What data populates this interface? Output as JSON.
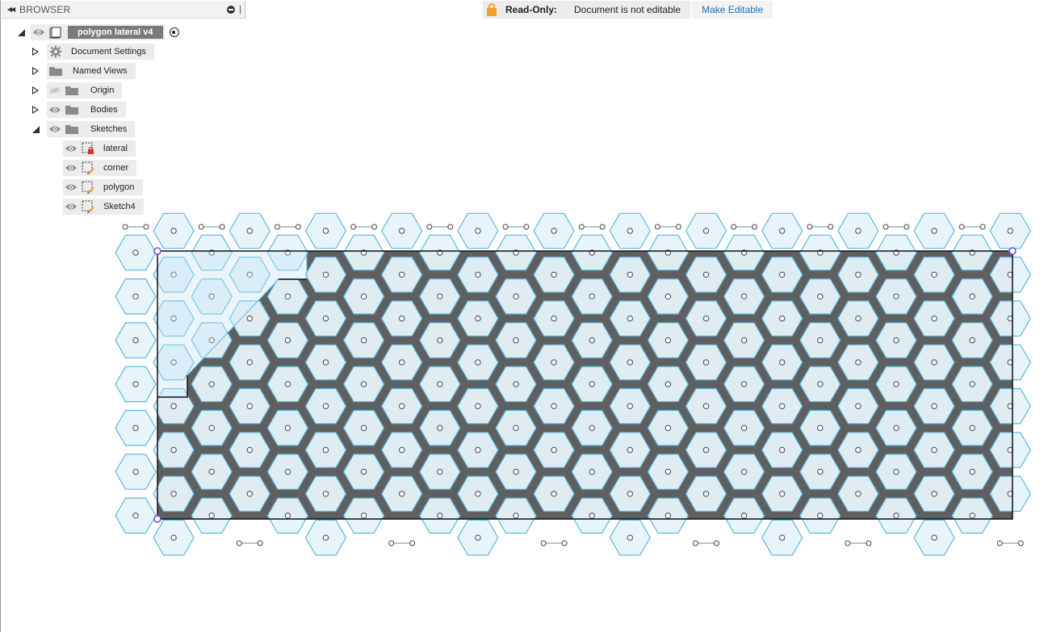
{
  "browser": {
    "title": "BROWSER",
    "root": {
      "label": "polygon lateral v4"
    },
    "items": [
      {
        "label": "Document Settings",
        "icon": "gear-icon"
      },
      {
        "label": "Named Views",
        "icon": "folder-icon"
      },
      {
        "label": "Origin",
        "icon": "folder-icon",
        "hidden": true
      },
      {
        "label": "Bodies",
        "icon": "folder-icon"
      },
      {
        "label": "Sketches",
        "icon": "folder-icon",
        "expanded": true
      }
    ],
    "sketches": [
      {
        "label": "lateral",
        "icon": "sketch-locked-icon"
      },
      {
        "label": "corner",
        "icon": "sketch-edit-icon"
      },
      {
        "label": "polygon",
        "icon": "sketch-edit-icon"
      },
      {
        "label": "Sketch4",
        "icon": "sketch-edit-icon"
      }
    ]
  },
  "banner": {
    "label": "Read-Only:",
    "text": "Document is not editable",
    "action": "Make Editable"
  },
  "colors": {
    "hex_fill": "#e6f4fb",
    "hex_stroke": "#5bb8de",
    "body_fill": "#5f5f5f",
    "lock": "#f0a020",
    "link": "#1b6fb3"
  }
}
